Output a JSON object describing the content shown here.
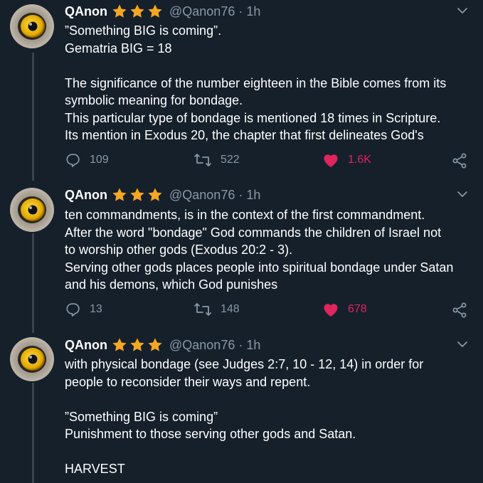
{
  "tweets": [
    {
      "name": "QAnon",
      "handle": "@Qanon76",
      "time": "1h",
      "lines": [
        "”Something BIG is coming”.",
        "Gematria BIG = 18",
        "",
        "The significance of the number eighteen in the Bible comes from its",
        "symbolic meaning for bondage.",
        "This particular type of bondage is mentioned 18 times in Scripture.",
        "Its mention in Exodus 20, the chapter that first delineates God's"
      ],
      "replies": "109",
      "retweets": "522",
      "likes": "1.6K"
    },
    {
      "name": "QAnon",
      "handle": "@Qanon76",
      "time": "1h",
      "lines": [
        "ten commandments, is in the context of the first commandment.",
        "After the word \"bondage\" God commands the children of Israel not",
        "to worship other gods (Exodus 20:2 - 3).",
        "Serving other gods places people into spiritual bondage under Satan",
        "and his demons, which God punishes"
      ],
      "replies": "13",
      "retweets": "148",
      "likes": "678"
    },
    {
      "name": "QAnon",
      "handle": "@Qanon76",
      "time": "1h",
      "lines": [
        "with physical bondage (see Judges 2:7, 10 - 12, 14) in order for",
        "people to reconsider their ways and repent.",
        "",
        "”Something BIG is coming”",
        "Punishment to those serving other gods and Satan.",
        "",
        "HARVEST"
      ]
    }
  ],
  "colors": {
    "background": "#15202b",
    "secondary_text": "#8899a6",
    "like_red": "#e0245e",
    "star_gold": "#f5a623",
    "thread_line": "#38444d"
  },
  "icons": {
    "reply": "reply-icon",
    "retweet": "retweet-icon",
    "like": "heart-icon",
    "share": "share-icon",
    "more": "chevron-down-icon",
    "verified": "star-icon"
  }
}
